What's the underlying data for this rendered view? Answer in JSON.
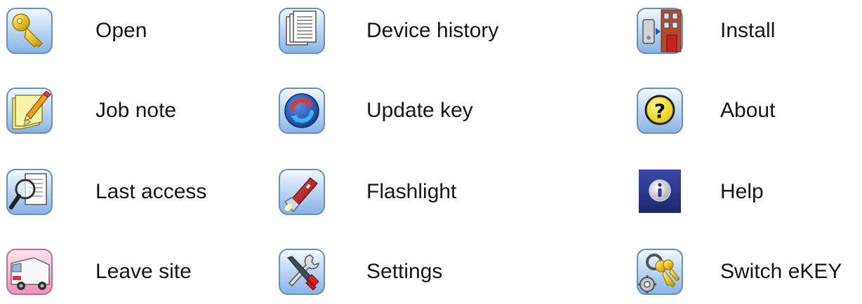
{
  "menu": {
    "items": [
      {
        "label": "Open",
        "icon": "key-icon"
      },
      {
        "label": "Device history",
        "icon": "documents-icon"
      },
      {
        "label": "Install",
        "icon": "install-icon"
      },
      {
        "label": "Job note",
        "icon": "note-pencil-icon"
      },
      {
        "label": "Update key",
        "icon": "sync-icon"
      },
      {
        "label": "About",
        "icon": "question-icon"
      },
      {
        "label": "Last access",
        "icon": "magnifier-document-icon"
      },
      {
        "label": "Flashlight",
        "icon": "flashlight-icon"
      },
      {
        "label": "Help",
        "icon": "info-icon"
      },
      {
        "label": "Leave site",
        "icon": "van-icon"
      },
      {
        "label": "Settings",
        "icon": "tools-icon"
      },
      {
        "label": "Switch eKEY",
        "icon": "keys-gear-icon"
      }
    ]
  },
  "colors": {
    "tile_top": "#eef6ff",
    "tile_bottom": "#8fb9ea",
    "tile_border": "#6a90c0",
    "key_gold": "#e8c52a",
    "sync_blue": "#1f56b8",
    "sync_red": "#d8362a",
    "question_yellow": "#f4e000",
    "info_navy": "#2a3a8c",
    "flashlight_red": "#c8141a"
  }
}
